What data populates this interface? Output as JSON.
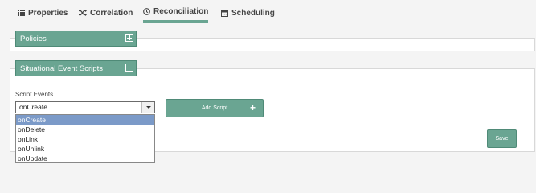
{
  "tabs": [
    {
      "label": "Properties",
      "icon": "list-icon",
      "active": false
    },
    {
      "label": "Correlation",
      "icon": "shuffle-icon",
      "active": false
    },
    {
      "label": "Reconciliation",
      "icon": "clock-icon",
      "active": true
    },
    {
      "label": "Scheduling",
      "icon": "calendar-icon",
      "active": false
    }
  ],
  "policies": {
    "title": "Policies",
    "expanded": false
  },
  "scripts": {
    "title": "Situational Event Scripts",
    "expanded": true,
    "events_label": "Script Events",
    "selected": "onCreate",
    "options": [
      "onCreate",
      "onDelete",
      "onLink",
      "onUnlink",
      "onUpdate"
    ],
    "add_label": "Add Script",
    "save_label": "Save"
  },
  "colors": {
    "accent": "#6aa592",
    "selection": "#7b9ac8"
  }
}
